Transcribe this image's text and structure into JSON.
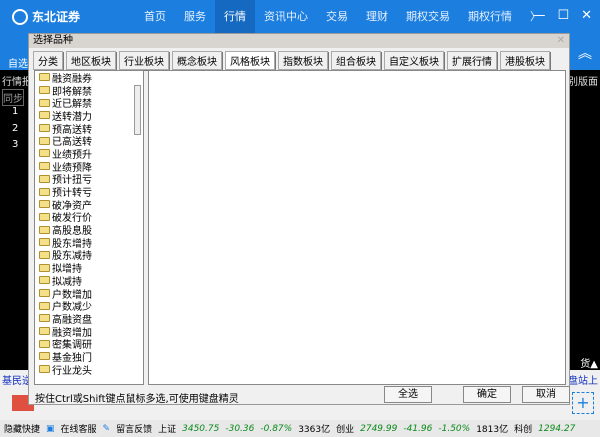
{
  "app": {
    "logo": "东北证券",
    "nav": [
      "首页",
      "服务",
      "行情",
      "资讯中心",
      "交易",
      "理财",
      "期权交易",
      "期权行情"
    ],
    "active_nav": "行情",
    "more": "〉",
    "min": "—",
    "max": "☐",
    "close": "✕"
  },
  "background": {
    "left_labels": [
      "自选",
      "行情报",
      "同步"
    ],
    "rows": [
      "1",
      "2",
      "3"
    ],
    "right_labels": [
      "别版面",
      "货▲",
      "盘站上"
    ],
    "bottom_left": "基民逆"
  },
  "dialog": {
    "title": "选择品种",
    "close": "✕",
    "tabs": [
      "分类",
      "地区板块",
      "行业板块",
      "概念板块",
      "风格板块",
      "指数板块",
      "组合板块",
      "自定义板块",
      "扩展行情",
      "港股板块"
    ],
    "active_tab": "风格板块",
    "items": [
      "融资融券",
      "即将解禁",
      "近已解禁",
      "送转潜力",
      "预高送转",
      "已高送转",
      "业绩预升",
      "业绩预降",
      "预计扭亏",
      "预计转亏",
      "破净资产",
      "破发行价",
      "高股息股",
      "股东增持",
      "股东减持",
      "拟增持",
      "拟减持",
      "户数增加",
      "户数减少",
      "高融资盘",
      "融资增加",
      "密集调研",
      "基金独门",
      "行业龙头"
    ],
    "hint": "按住Ctrl或Shift键点鼠标多选,可使用键盘精灵",
    "select_all": "全选",
    "ok": "确定",
    "cancel": "取消"
  },
  "status": {
    "hide": "隐藏快捷",
    "service": "在线客服",
    "feedback": "留言反馈",
    "sh": {
      "name": "上证",
      "value": "3450.75",
      "change": "-30.36",
      "pct": "-0.87%",
      "vol": "3363亿"
    },
    "cy": {
      "name": "创业",
      "value": "2749.99",
      "change": "-41.96",
      "pct": "-1.50%",
      "vol": "1813亿"
    },
    "kc": {
      "name": "科创",
      "value": "1294.27"
    }
  }
}
